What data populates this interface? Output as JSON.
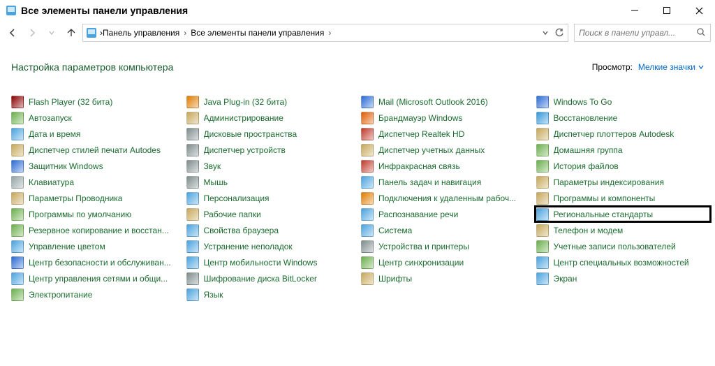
{
  "window": {
    "title": "Все элементы панели управления"
  },
  "breadcrumb": {
    "part1": "Панель управления",
    "part2": "Все элементы панели управления"
  },
  "search": {
    "placeholder": "Поиск в панели управл..."
  },
  "subheader": {
    "title": "Настройка параметров компьютера",
    "view_label": "Просмотр:",
    "view_value": "Мелкие значки"
  },
  "items": [
    {
      "label": "Flash Player (32 бита)",
      "icon": "flash",
      "col": 0
    },
    {
      "label": "Java Plug-in (32 бита)",
      "icon": "java",
      "col": 1
    },
    {
      "label": "Mail (Microsoft Outlook 2016)",
      "icon": "mail",
      "col": 2
    },
    {
      "label": "Windows To Go",
      "icon": "wtg",
      "col": 3
    },
    {
      "label": "Автозапуск",
      "icon": "autoplay",
      "col": 0
    },
    {
      "label": "Администрирование",
      "icon": "admin",
      "col": 1
    },
    {
      "label": "Брандмауэр Windows",
      "icon": "firewall",
      "col": 2
    },
    {
      "label": "Восстановление",
      "icon": "recovery",
      "col": 3
    },
    {
      "label": "Дата и время",
      "icon": "datetime",
      "col": 0
    },
    {
      "label": "Дисковые пространства",
      "icon": "storage",
      "col": 1
    },
    {
      "label": "Диспетчер Realtek HD",
      "icon": "realtek",
      "col": 2
    },
    {
      "label": "Диспетчер плоттеров Autodesk",
      "icon": "plotter",
      "col": 3
    },
    {
      "label": "Диспетчер стилей печати Autodes",
      "icon": "printstyle",
      "col": 0
    },
    {
      "label": "Диспетчер устройств",
      "icon": "devmgr",
      "col": 1
    },
    {
      "label": "Диспетчер учетных данных",
      "icon": "credmgr",
      "col": 2
    },
    {
      "label": "Домашняя группа",
      "icon": "homegroup",
      "col": 3
    },
    {
      "label": "Защитник Windows",
      "icon": "defender",
      "col": 0
    },
    {
      "label": "Звук",
      "icon": "sound",
      "col": 1
    },
    {
      "label": "Инфракрасная связь",
      "icon": "infrared",
      "col": 2
    },
    {
      "label": "История файлов",
      "icon": "filehist",
      "col": 3
    },
    {
      "label": "Клавиатура",
      "icon": "keyboard",
      "col": 0
    },
    {
      "label": "Мышь",
      "icon": "mouse",
      "col": 1
    },
    {
      "label": "Панель задач и навигация",
      "icon": "taskbar",
      "col": 2
    },
    {
      "label": "Параметры индексирования",
      "icon": "indexing",
      "col": 3
    },
    {
      "label": "Параметры Проводника",
      "icon": "folderopt",
      "col": 0
    },
    {
      "label": "Персонализация",
      "icon": "personalize",
      "col": 1
    },
    {
      "label": "Подключения к удаленным рабоч...",
      "icon": "remote",
      "col": 2
    },
    {
      "label": "Программы и компоненты",
      "icon": "programs",
      "col": 3
    },
    {
      "label": "Программы по умолчанию",
      "icon": "defaults",
      "col": 0
    },
    {
      "label": "Рабочие папки",
      "icon": "workfolders",
      "col": 1
    },
    {
      "label": "Распознавание речи",
      "icon": "speech",
      "col": 2
    },
    {
      "label": "Региональные стандарты",
      "icon": "region",
      "col": 3,
      "highlight": true
    },
    {
      "label": "Резервное копирование и восстан...",
      "icon": "backup",
      "col": 0
    },
    {
      "label": "Свойства браузера",
      "icon": "inetopt",
      "col": 1
    },
    {
      "label": "Система",
      "icon": "system",
      "col": 2
    },
    {
      "label": "Телефон и модем",
      "icon": "phone",
      "col": 3
    },
    {
      "label": "Управление цветом",
      "icon": "color",
      "col": 0
    },
    {
      "label": "Устранение неполадок",
      "icon": "troubleshoot",
      "col": 1
    },
    {
      "label": "Устройства и принтеры",
      "icon": "devices",
      "col": 2
    },
    {
      "label": "Учетные записи пользователей",
      "icon": "users",
      "col": 3
    },
    {
      "label": "Центр безопасности и обслуживан...",
      "icon": "security",
      "col": 0
    },
    {
      "label": "Центр мобильности Windows",
      "icon": "mobility",
      "col": 1
    },
    {
      "label": "Центр синхронизации",
      "icon": "sync",
      "col": 2
    },
    {
      "label": "Центр специальных возможностей",
      "icon": "ease",
      "col": 3
    },
    {
      "label": "Центр управления сетями и общи...",
      "icon": "network",
      "col": 0
    },
    {
      "label": "Шифрование диска BitLocker",
      "icon": "bitlocker",
      "col": 1
    },
    {
      "label": "Шрифты",
      "icon": "fonts",
      "col": 2
    },
    {
      "label": "Экран",
      "icon": "display",
      "col": 3
    },
    {
      "label": "Электропитание",
      "icon": "power",
      "col": 0
    },
    {
      "label": "Язык",
      "icon": "language",
      "col": 1
    }
  ],
  "icon_colors": {
    "flash": "#8b0000",
    "java": "#e07c00",
    "mail": "#2a6bd4",
    "wtg": "#2a6bd4",
    "autoplay": "#6ab04c",
    "admin": "#c7a85a",
    "firewall": "#e05a00",
    "recovery": "#3498db",
    "datetime": "#4aa3df",
    "storage": "#7f8c8d",
    "realtek": "#c0392b",
    "plotter": "#c7a85a",
    "printstyle": "#c7a85a",
    "devmgr": "#7f8c8d",
    "credmgr": "#c7a85a",
    "homegroup": "#6ab04c",
    "defender": "#2a6bd4",
    "sound": "#7f8c8d",
    "infrared": "#c0392b",
    "filehist": "#6ab04c",
    "keyboard": "#95a5a6",
    "mouse": "#7f8c8d",
    "taskbar": "#4aa3df",
    "indexing": "#c7a85a",
    "folderopt": "#c7a85a",
    "personalize": "#4aa3df",
    "remote": "#e07c00",
    "programs": "#c7a85a",
    "defaults": "#6ab04c",
    "workfolders": "#c7a85a",
    "speech": "#4aa3df",
    "region": "#4aa3df",
    "backup": "#6ab04c",
    "inetopt": "#4aa3df",
    "system": "#4aa3df",
    "phone": "#c7a85a",
    "color": "#4aa3df",
    "troubleshoot": "#4aa3df",
    "devices": "#7f8c8d",
    "users": "#6ab04c",
    "security": "#2a6bd4",
    "mobility": "#4aa3df",
    "sync": "#6ab04c",
    "ease": "#4aa3df",
    "network": "#4aa3df",
    "bitlocker": "#7f8c8d",
    "fonts": "#c7a85a",
    "display": "#4aa3df",
    "power": "#6ab04c",
    "language": "#4aa3df"
  }
}
